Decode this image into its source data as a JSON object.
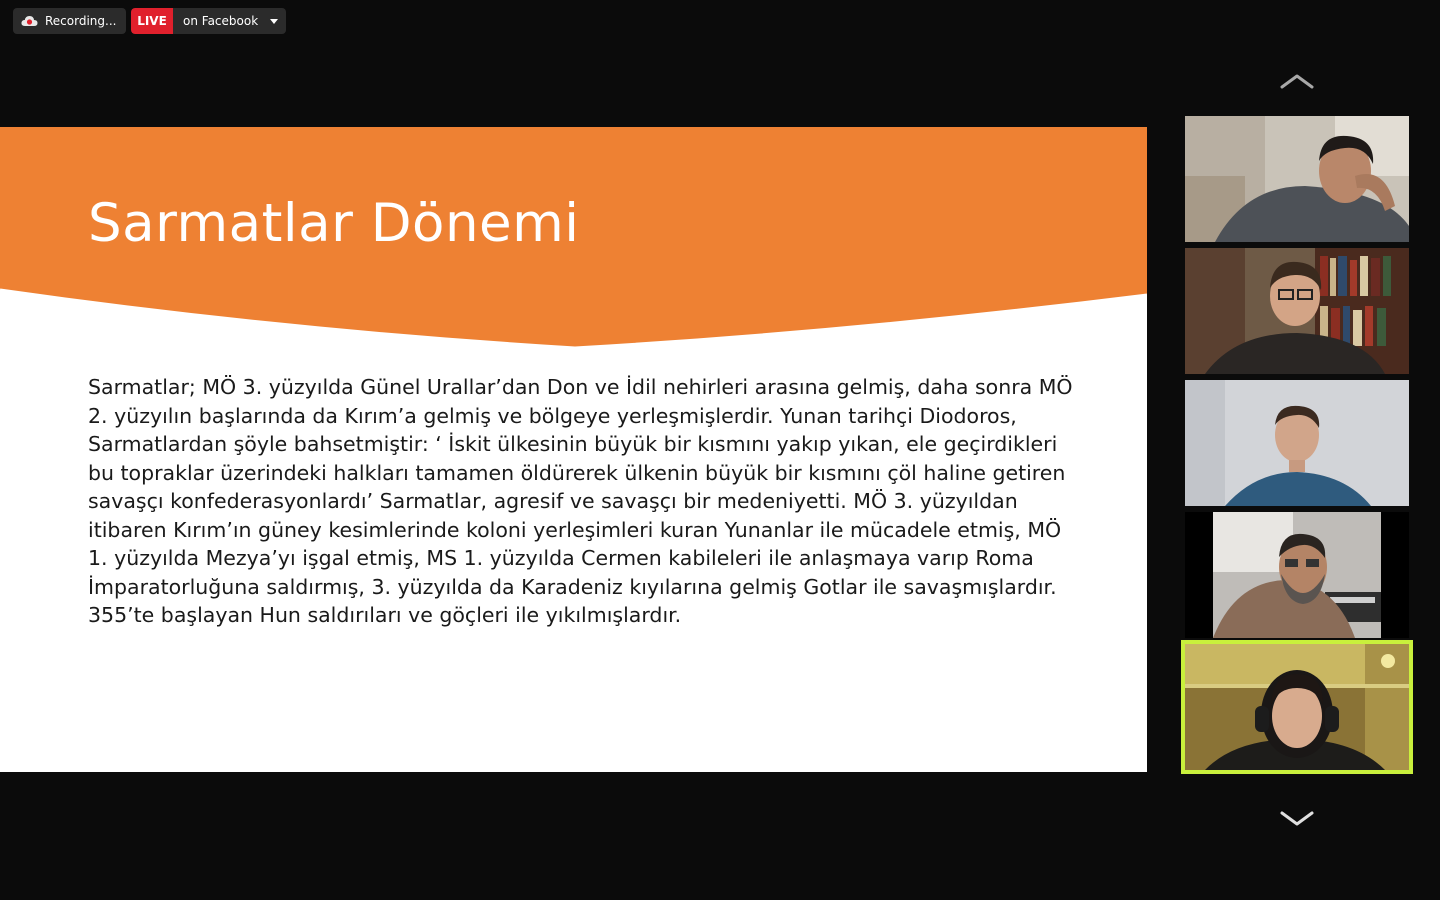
{
  "topbar": {
    "recording_label": "Recording...",
    "live_badge": "LIVE",
    "live_target": "on Facebook",
    "cloud_icon": "cloud-recording-icon",
    "caret_icon": "chevron-down-icon"
  },
  "slide": {
    "title": "Sarmatlar Dönemi",
    "body": "Sarmatlar; MÖ 3. yüzyılda Günel Urallar’dan Don ve İdil nehirleri arasına gelmiş, daha sonra MÖ 2. yüzyılın başlarında da Kırım’a gelmiş ve bölgeye yerleşmişlerdir. Yunan tarihçi Diodoros, Sarmatlardan şöyle bahsetmiştir: ‘ İskit ülkesinin büyük bir kısmını yakıp yıkan, ele geçirdikleri bu topraklar üzerindeki halkları tamamen öldürerek ülkenin büyük bir kısmını çöl haline getiren savaşçı konfederasyonlardı’ Sarmatlar, agresif ve savaşçı bir medeniyetti. MÖ 3. yüzyıldan itibaren Kırım’ın güney kesimlerinde koloni yerleşimleri kuran Yunanlar ile mücadele etmiş, MÖ 1. yüzyılda Mezya’yı işgal etmiş, MS 1. yüzyılda Cermen kabileleri ile anlaşmaya varıp Roma İmparatorluğuna saldırmış, 3. yüzyılda da Karadeniz kıyılarına gelmiş Gotlar ile savaşmışlardır. 355’te başlayan Hun saldırıları ve göçleri ile yıkılmışlardır.",
    "header_color": "#ee8133"
  },
  "gallery": {
    "scroll_up_icon": "chevron-up-icon",
    "scroll_down_icon": "chevron-down-icon",
    "active_speaker_color": "#c9f03c",
    "participants": [
      {
        "id": "participant-1",
        "active": false
      },
      {
        "id": "participant-2",
        "active": false
      },
      {
        "id": "participant-3",
        "active": false
      },
      {
        "id": "participant-4",
        "active": false
      },
      {
        "id": "participant-5",
        "active": true
      }
    ]
  }
}
